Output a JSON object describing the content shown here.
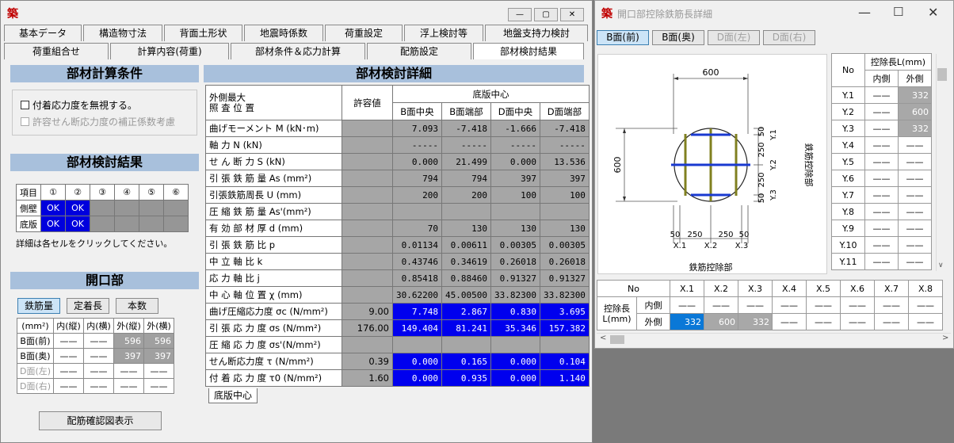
{
  "main_window": {
    "logo": "築",
    "controls": {
      "minimize": "—",
      "maximize": "▢",
      "close": "✕"
    },
    "tabs_row1": [
      "基本データ",
      "構造物寸法",
      "背面土形状",
      "地震時係数",
      "荷重設定",
      "浮上検討等",
      "地盤支持力検討"
    ],
    "tabs_row2": [
      "荷重組合せ",
      "計算内容(荷重)",
      "部材条件＆応力計算",
      "配筋設定",
      "部材検討結果"
    ],
    "calc_conditions": {
      "title": "部材計算条件",
      "opt1": "付着応力度を無視する。",
      "opt2": "許容せん断応力度の補正係数考慮"
    },
    "check_results": {
      "title": "部材検討結果",
      "head": [
        "項目",
        "①",
        "②",
        "③",
        "④",
        "⑤",
        "⑥"
      ],
      "rows": [
        {
          "label": "側壁",
          "cells": [
            "OK",
            "OK",
            "",
            "",
            "",
            ""
          ]
        },
        {
          "label": "底版",
          "cells": [
            "OK",
            "OK",
            "",
            "",
            "",
            ""
          ]
        }
      ],
      "note": "詳細は各セルをクリックしてください。"
    },
    "opening": {
      "title": "開口部",
      "buttons": [
        "鉄筋量",
        "定着長",
        "本数"
      ],
      "head": [
        "(mm²)",
        "内(縦)",
        "内(横)",
        "外(縦)",
        "外(横)"
      ],
      "rows": [
        {
          "label": "B面(前)",
          "cells": [
            "——",
            "——",
            "596",
            "596"
          ]
        },
        {
          "label": "B面(奥)",
          "cells": [
            "——",
            "——",
            "397",
            "397"
          ]
        },
        {
          "label": "D面(左)",
          "cells": [
            "——",
            "——",
            "——",
            "——"
          ]
        },
        {
          "label": "D面(右)",
          "cells": [
            "——",
            "——",
            "——",
            "——"
          ]
        }
      ]
    },
    "rebar_button": "配筋確認図表示",
    "detail": {
      "title": "部材検討詳細",
      "h_label": "外側最大\n照 査 位 置",
      "h_allow": "許容値",
      "h_group": "底版中心",
      "cols": [
        "B面中央",
        "B面端部",
        "D面中央",
        "D面端部"
      ],
      "rows": [
        {
          "label": "曲げモーメント M (kN･m)",
          "allow": "",
          "vals": [
            "7.093",
            "-7.418",
            "-1.666",
            "-7.418"
          ],
          "blue": false
        },
        {
          "label": "軸 力 N (kN)",
          "allow": "",
          "vals": [
            "-----",
            "-----",
            "-----",
            "-----"
          ],
          "blue": false
        },
        {
          "label": "せ ん 断 力 S (kN)",
          "allow": "",
          "vals": [
            "0.000",
            "21.499",
            "0.000",
            "13.536"
          ],
          "blue": false
        },
        {
          "label": "引 張 鉄 筋 量 As (mm²)",
          "allow": "",
          "vals": [
            "794",
            "794",
            "397",
            "397"
          ],
          "blue": false
        },
        {
          "label": "引張鉄筋周長 U (mm)",
          "allow": "",
          "vals": [
            "200",
            "200",
            "100",
            "100"
          ],
          "blue": false
        },
        {
          "label": "圧 縮 鉄 筋 量 As'(mm²)",
          "allow": "",
          "vals": [
            "",
            "",
            "",
            ""
          ],
          "blue": false
        },
        {
          "label": "有 効 部 材 厚 d (mm)",
          "allow": "",
          "vals": [
            "70",
            "130",
            "130",
            "130"
          ],
          "blue": false
        },
        {
          "label": "引 張 鉄 筋 比 p",
          "allow": "",
          "vals": [
            "0.01134",
            "0.00611",
            "0.00305",
            "0.00305"
          ],
          "blue": false
        },
        {
          "label": "中 立 軸 比 k",
          "allow": "",
          "vals": [
            "0.43746",
            "0.34619",
            "0.26018",
            "0.26018"
          ],
          "blue": false
        },
        {
          "label": "応 力 軸 比 j",
          "allow": "",
          "vals": [
            "0.85418",
            "0.88460",
            "0.91327",
            "0.91327"
          ],
          "blue": false
        },
        {
          "label": "中 心 軸 位 置 χ (mm)",
          "allow": "",
          "vals": [
            "30.62200",
            "45.00500",
            "33.82300",
            "33.82300"
          ],
          "blue": false
        },
        {
          "label": "曲げ圧縮応力度 σc (N/mm²)",
          "allow": "9.00",
          "vals": [
            "7.748",
            "2.867",
            "0.830",
            "3.695"
          ],
          "blue": true
        },
        {
          "label": "引 張 応 力 度 σs (N/mm²)",
          "allow": "176.00",
          "vals": [
            "149.404",
            "81.241",
            "35.346",
            "157.382"
          ],
          "blue": true
        },
        {
          "label": "圧 縮 応 力 度 σs'(N/mm²)",
          "allow": "",
          "vals": [
            "",
            "",
            "",
            ""
          ],
          "blue": false
        },
        {
          "label": "せん断応力度 τ (N/mm²)",
          "allow": "0.39",
          "vals": [
            "0.000",
            "0.165",
            "0.000",
            "0.104"
          ],
          "blue": true
        },
        {
          "label": "付 着 応 力 度 τ0 (N/mm²)",
          "allow": "1.60",
          "vals": [
            "0.000",
            "0.935",
            "0.000",
            "1.140"
          ],
          "blue": true
        }
      ],
      "bottom_tab": "底版中心"
    }
  },
  "sub_window": {
    "logo": "築",
    "title": "開口部控除鉄筋長詳細",
    "tabs": [
      "B面(前)",
      "B面(奥)",
      "D面(左)",
      "D面(右)"
    ],
    "diagram": {
      "top_dim": "600",
      "left_dim": "600",
      "right_dims": [
        "50",
        "250",
        "250",
        "50"
      ],
      "bottom_dims": [
        "50",
        "250",
        "250",
        "50"
      ],
      "y_labels": [
        "Y.1",
        "Y.2",
        "Y.3"
      ],
      "x_labels": [
        "X.1",
        "X.2",
        "X.3"
      ],
      "side_caption": "鉄筋控除部",
      "bottom_caption": "鉄筋控除部"
    },
    "ytable": {
      "head_no": "No",
      "head_group": "控除長L(mm)",
      "head_in": "内側",
      "head_out": "外側",
      "rows": [
        {
          "no": "Y.1",
          "in": "——",
          "out": "332"
        },
        {
          "no": "Y.2",
          "in": "——",
          "out": "600"
        },
        {
          "no": "Y.3",
          "in": "——",
          "out": "332"
        },
        {
          "no": "Y.4",
          "in": "——",
          "out": "——"
        },
        {
          "no": "Y.5",
          "in": "——",
          "out": "——"
        },
        {
          "no": "Y.6",
          "in": "——",
          "out": "——"
        },
        {
          "no": "Y.7",
          "in": "——",
          "out": "——"
        },
        {
          "no": "Y.8",
          "in": "——",
          "out": "——"
        },
        {
          "no": "Y.9",
          "in": "——",
          "out": "——"
        },
        {
          "no": "Y.10",
          "in": "——",
          "out": "——"
        },
        {
          "no": "Y.11",
          "in": "——",
          "out": "——"
        }
      ]
    },
    "xtable": {
      "head_no": "No",
      "cols": [
        "X.1",
        "X.2",
        "X.3",
        "X.4",
        "X.5",
        "X.6",
        "X.7",
        "X.8"
      ],
      "row_label": "控除長\nL(mm)",
      "in_label": "内側",
      "out_label": "外側",
      "in_vals": [
        "——",
        "——",
        "——",
        "——",
        "——",
        "——",
        "——",
        "——"
      ],
      "out_vals": [
        "332",
        "600",
        "332",
        "——",
        "——",
        "——",
        "——",
        "——"
      ]
    }
  }
}
